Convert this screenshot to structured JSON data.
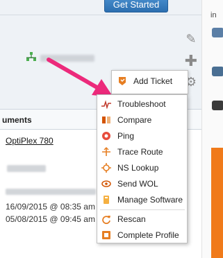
{
  "header": {
    "get_started_label": "Get Started"
  },
  "device": {
    "section_title": "uments",
    "model_link": "OptiPlex 780"
  },
  "dates": [
    "16/09/2015 @ 08:35 am",
    "05/08/2015 @ 09:45 am"
  ],
  "right_panel": {
    "label": "in"
  },
  "add_menu": {
    "add_ticket_label": "Add Ticket"
  },
  "context_menu": {
    "items": [
      {
        "label": "Troubleshoot",
        "icon": "pulse-icon",
        "color": "#c0392b"
      },
      {
        "label": "Compare",
        "icon": "compare-icon",
        "color": "#d35400"
      },
      {
        "label": "Ping",
        "icon": "ping-icon",
        "color": "#e74c3c"
      },
      {
        "label": "Trace Route",
        "icon": "trace-route-icon",
        "color": "#e67e22"
      },
      {
        "label": "NS Lookup",
        "icon": "ns-lookup-icon",
        "color": "#e67e22"
      },
      {
        "label": "Send WOL",
        "icon": "wol-icon",
        "color": "#d35400"
      },
      {
        "label": "Manage Software",
        "icon": "software-icon",
        "color": "#e67e22"
      },
      {
        "label": "Rescan",
        "icon": "rescan-icon",
        "color": "#e67e22"
      },
      {
        "label": "Complete Profile",
        "icon": "profile-icon",
        "color": "#e67e22"
      }
    ]
  },
  "colors": {
    "accent_orange": "#f07a1a",
    "arrow_pink": "#ec2a7b",
    "button_blue": "#2c6fb0"
  }
}
